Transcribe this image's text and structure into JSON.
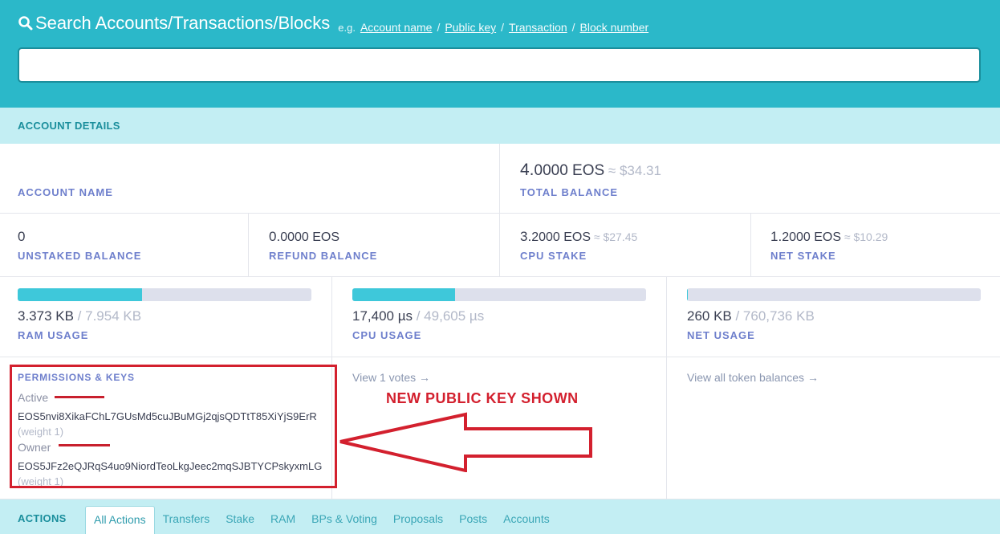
{
  "search": {
    "title": "Search Accounts/Transactions/Blocks",
    "eg": "e.g.",
    "hints": [
      "Account name",
      "Public key",
      "Transaction",
      "Block number"
    ],
    "sep": "/",
    "value": ""
  },
  "account_details": {
    "title": "ACCOUNT DETAILS",
    "account_name_label": "ACCOUNT NAME",
    "total_balance": {
      "main": "4.",
      "rest": "0000 EOS",
      "approx": " ≈ $34.31",
      "label": "TOTAL BALANCE"
    },
    "unstaked": {
      "main": "0",
      "label": "UNSTAKED BALANCE"
    },
    "refund": {
      "main": "0.",
      "rest": "0000 EOS",
      "label": "REFUND BALANCE"
    },
    "cpu_stake": {
      "main": "3.",
      "rest": "2000 EOS",
      "approx": " ≈ $27.45",
      "label": "CPU STAKE"
    },
    "net_stake": {
      "main": "1.",
      "rest": "2000 EOS",
      "approx": " ≈ $10.29",
      "label": "NET STAKE"
    }
  },
  "usage": {
    "ram": {
      "used": "3.373 KB",
      "total": " / 7.954 KB",
      "label": "RAM USAGE",
      "fraction": 0.424
    },
    "cpu": {
      "used": "17,400 µs",
      "total": " / 49,605 µs",
      "label": "CPU USAGE",
      "fraction": 0.351
    },
    "net": {
      "used": "260 KB",
      "total": " / 760,736 KB",
      "label": "NET USAGE",
      "fraction": 0.0003
    }
  },
  "permissions": {
    "title": "PERMISSIONS & KEYS",
    "active_label": "Active",
    "active_key": "EOS5nvi8XikaFChL7GUsMd5cuJBuMGj2qjsQDTtT85XiYjS9ErR",
    "active_weight": "(weight 1)",
    "owner_label": "Owner",
    "owner_key": "EOS5JFz2eQJRqS4uo9NiordTeoLkgJeec2mqSJBTYCPskyxmLG",
    "owner_weight": "(weight 1)"
  },
  "links": {
    "votes": "View 1 votes →",
    "token_balances": "View all token balances →"
  },
  "annotation": {
    "text": "NEW PUBLIC KEY SHOWN",
    "color": "#d3202e"
  },
  "actions": {
    "title": "ACTIONS",
    "tabs": [
      "All Actions",
      "Transfers",
      "Stake",
      "RAM",
      "BPs & Voting",
      "Proposals",
      "Posts",
      "Accounts"
    ]
  },
  "colors": {
    "header": "#2bb8c9",
    "accent": "#3ec8da",
    "section": "#c3eef3"
  }
}
